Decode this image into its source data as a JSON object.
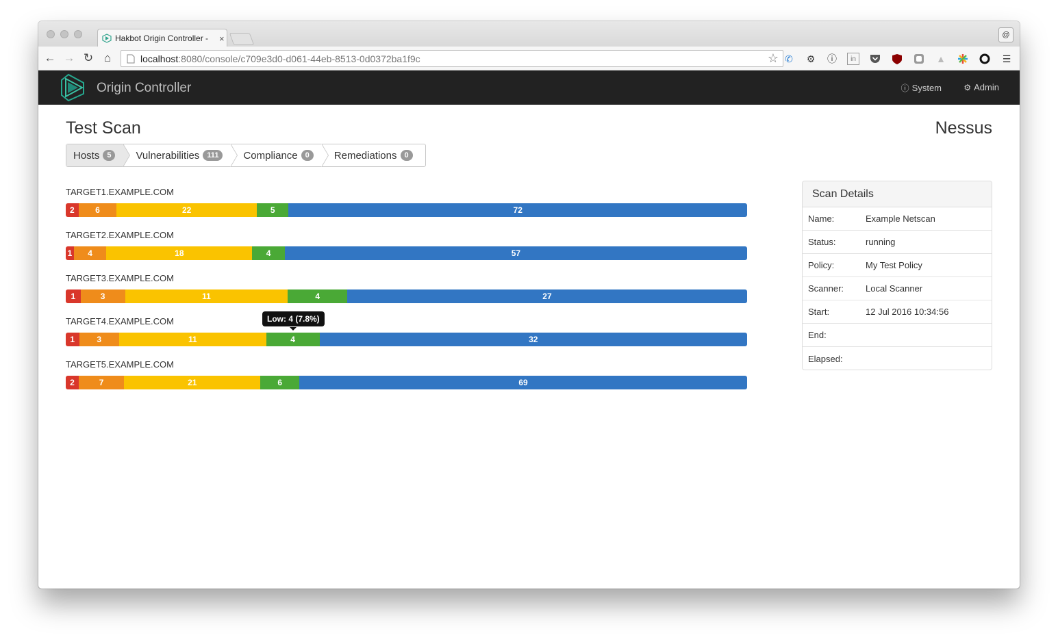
{
  "browser": {
    "tab_title": "Hakbot Origin Controller - ",
    "tab_close": "×",
    "url_host": "localhost",
    "url_rest": ":8080/console/c709e3d0-d061-44eb-8513-0d0372ba1f9c",
    "profile": "@"
  },
  "app": {
    "brand": "Origin Controller",
    "nav": {
      "system": "System",
      "admin": "Admin"
    }
  },
  "page": {
    "title": "Test Scan",
    "scanner": "Nessus"
  },
  "tabs": [
    {
      "label": "Hosts",
      "count": "5"
    },
    {
      "label": "Vulnerabilities",
      "count": "111"
    },
    {
      "label": "Compliance",
      "count": "0"
    },
    {
      "label": "Remediations",
      "count": "0"
    }
  ],
  "colors": {
    "critical": "#d9372b",
    "high": "#ef8c1b",
    "medium": "#fac300",
    "low": "#4aa936",
    "info": "#3276c3",
    "navbar": "#222222"
  },
  "chart_data": {
    "type": "bar",
    "orientation": "horizontal-stacked",
    "categories": [
      "TARGET1.EXAMPLE.COM",
      "TARGET2.EXAMPLE.COM",
      "TARGET3.EXAMPLE.COM",
      "TARGET4.EXAMPLE.COM",
      "TARGET5.EXAMPLE.COM"
    ],
    "series": [
      {
        "key": "critical",
        "values": [
          2,
          1,
          1,
          1,
          2
        ]
      },
      {
        "key": "high",
        "values": [
          6,
          4,
          3,
          3,
          7
        ]
      },
      {
        "key": "medium",
        "values": [
          22,
          18,
          11,
          11,
          21
        ]
      },
      {
        "key": "low",
        "values": [
          5,
          4,
          4,
          4,
          6
        ]
      },
      {
        "key": "info",
        "values": [
          72,
          57,
          27,
          32,
          69
        ]
      }
    ]
  },
  "tooltip": {
    "text": "Low: 4 (7.8%)"
  },
  "scan_details": {
    "heading": "Scan Details",
    "rows": [
      {
        "key": "Name:",
        "value": "Example Netscan"
      },
      {
        "key": "Status:",
        "value": "running"
      },
      {
        "key": "Policy:",
        "value": "My Test Policy"
      },
      {
        "key": "Scanner:",
        "value": "Local Scanner"
      },
      {
        "key": "Start:",
        "value": "12 Jul 2016 10:34:56"
      },
      {
        "key": "End:",
        "value": ""
      },
      {
        "key": "Elapsed:",
        "value": ""
      }
    ]
  }
}
